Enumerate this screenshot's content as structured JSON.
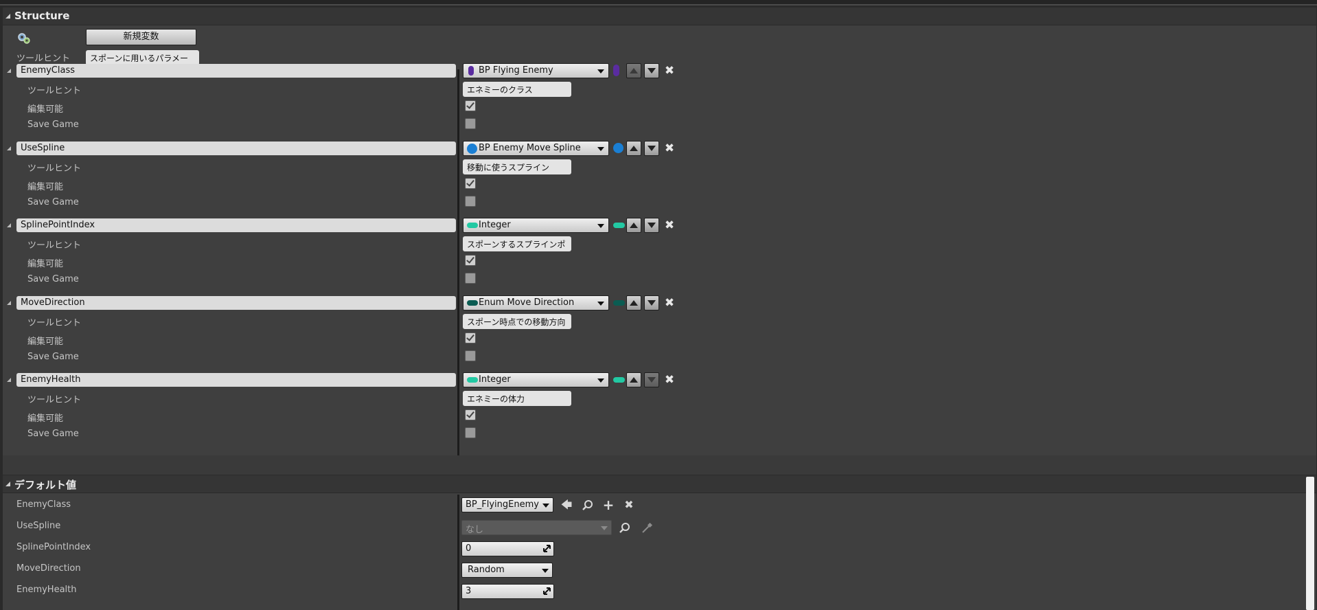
{
  "structure": {
    "title": "Structure",
    "new_variable_button": "新規変数",
    "tooltip_label": "ツールヒント",
    "tooltip_value": "スポーンに用いるパラメー",
    "sub_labels": {
      "tooltip": "ツールヒント",
      "editable": "編集可能",
      "save_game": "Save Game"
    },
    "variables": [
      {
        "name": "EnemyClass",
        "type": "BP Flying Enemy",
        "type_color": "#5a2ca0",
        "tooltip": "エネミーのクラス",
        "editable": true,
        "save_game": false,
        "up_enabled": false,
        "down_enabled": true
      },
      {
        "name": "UseSpline",
        "type": "BP Enemy Move Spline",
        "type_color": "#1a7fd4",
        "tooltip": "移動に使うスプライン",
        "editable": true,
        "save_game": false,
        "up_enabled": true,
        "down_enabled": true
      },
      {
        "name": "SplinePointIndex",
        "type": "Integer",
        "type_color": "#22c9a3",
        "tooltip": "スポーンするスプラインポ",
        "editable": true,
        "save_game": false,
        "up_enabled": true,
        "down_enabled": true
      },
      {
        "name": "MoveDirection",
        "type": "Enum Move Direction",
        "type_color": "#0b5c52",
        "tooltip": "スポーン時点での移動方向",
        "editable": true,
        "save_game": false,
        "up_enabled": true,
        "down_enabled": true
      },
      {
        "name": "EnemyHealth",
        "type": "Integer",
        "type_color": "#22c9a3",
        "tooltip": "エネミーの体力",
        "editable": true,
        "save_game": false,
        "up_enabled": true,
        "down_enabled": false
      }
    ]
  },
  "defaults": {
    "title": "デフォルト値",
    "rows": [
      {
        "label": "EnemyClass",
        "value": "BP_FlyingEnemy"
      },
      {
        "label": "UseSpline",
        "value": "なし"
      },
      {
        "label": "SplinePointIndex",
        "value": "0"
      },
      {
        "label": "MoveDirection",
        "value": "Random"
      },
      {
        "label": "EnemyHealth",
        "value": "3"
      }
    ]
  },
  "icons": {
    "settings": "gears-icon",
    "x": "close-icon",
    "use_selected": "arrow-left-icon",
    "browse": "magnifier-icon",
    "add": "plus-icon",
    "clear": "close-icon",
    "picker": "eyedropper-icon"
  }
}
